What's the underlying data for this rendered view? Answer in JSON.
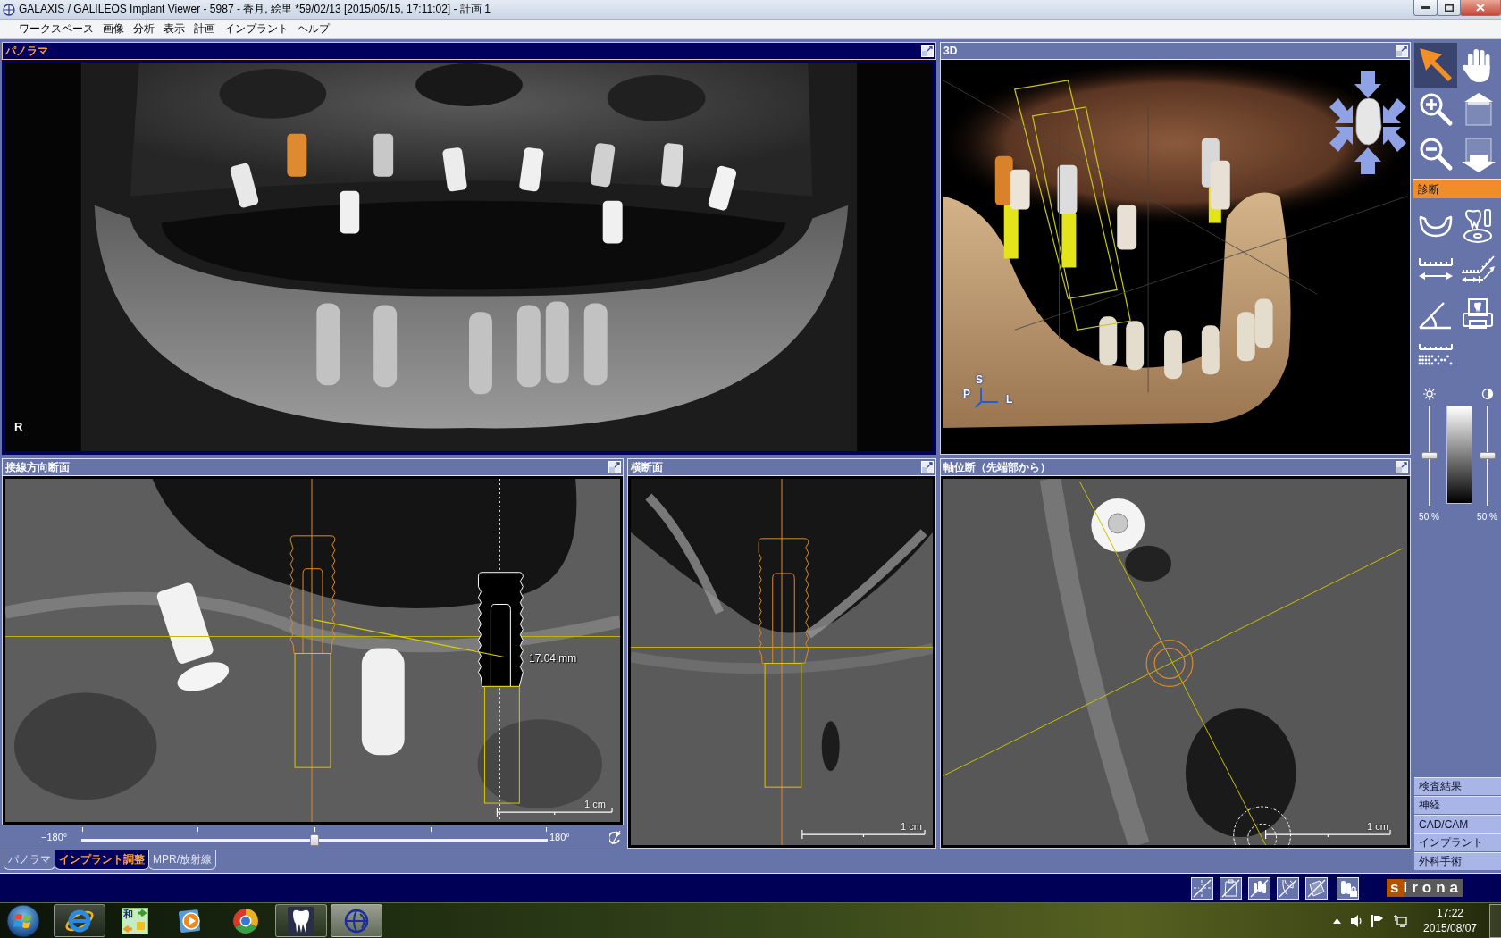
{
  "window": {
    "title": "GALAXIS / GALILEOS Implant Viewer - 5987 - 香月, 絵里 *59/02/13 [2015/05/15, 17:11:02] - 計画 1"
  },
  "menu": [
    "ワークスペース",
    "画像",
    "分析",
    "表示",
    "計画",
    "インプラント",
    "ヘルプ"
  ],
  "views": [
    {
      "kind": "panorama",
      "title": "パノラマ",
      "active": true,
      "side_label": "R"
    },
    {
      "kind": "volume",
      "title": "3D",
      "active": false,
      "axis_labels": [
        "S",
        "P",
        "L"
      ]
    },
    {
      "kind": "tangential",
      "title": "接線方向断面",
      "active": false,
      "measurement": "17.04 mm",
      "scale": "1 cm",
      "rotation": {
        "min_label": "−180°",
        "max_label": "180°",
        "level": 0.5
      }
    },
    {
      "kind": "cross",
      "title": "横断面",
      "active": false,
      "scale": "1 cm"
    },
    {
      "kind": "axial",
      "title": "軸位断（先端部から）",
      "active": false,
      "scale": "1 cm"
    }
  ],
  "view_tabs": [
    {
      "label": "パノラマ",
      "selected": false
    },
    {
      "label": "インプラント調整",
      "selected": true
    },
    {
      "label": "MPR/放射線",
      "selected": false
    }
  ],
  "tools": [
    {
      "kind": "pointer",
      "selected": true
    },
    {
      "kind": "pan",
      "selected": false
    },
    {
      "kind": "zoom-in",
      "selected": false
    },
    {
      "kind": "slice-up",
      "selected": false
    },
    {
      "kind": "zoom-out",
      "selected": false
    },
    {
      "kind": "slice-down",
      "selected": false
    }
  ],
  "diagnosis": {
    "title": "診断",
    "tools": [
      {
        "kind": "jaw"
      },
      {
        "kind": "tooth-scan"
      },
      {
        "kind": "ruler"
      },
      {
        "kind": "angled-ruler"
      },
      {
        "kind": "angle"
      },
      {
        "kind": "print"
      },
      {
        "kind": "density-ruler"
      }
    ]
  },
  "image_controls": [
    {
      "kind": "brightness",
      "level": 0.5,
      "reading": "50 %"
    },
    {
      "kind": "contrast",
      "level": 0.5,
      "reading": "50 %"
    }
  ],
  "sections": [
    "検査結果",
    "神経",
    "CAD/CAM",
    "インプラント",
    "外科手術"
  ],
  "view_toggles": [
    {
      "kind": "crosshair"
    },
    {
      "kind": "clipboard"
    },
    {
      "kind": "implants"
    },
    {
      "kind": "nerve"
    },
    {
      "kind": "plane"
    },
    {
      "kind": "implant-lock"
    }
  ],
  "logo": "sirona",
  "taskbar": {
    "apps": [
      {
        "kind": "ie",
        "running": true,
        "selected": false
      },
      {
        "kind": "converter",
        "glyph": "和",
        "running": false,
        "selected": false
      },
      {
        "kind": "media",
        "running": false,
        "selected": false
      },
      {
        "kind": "chrome",
        "running": false,
        "selected": false
      },
      {
        "kind": "tooth",
        "running": true,
        "selected": false
      },
      {
        "kind": "galaxis",
        "running": true,
        "selected": true
      }
    ],
    "time": "17:22",
    "date": "2015/08/07"
  }
}
